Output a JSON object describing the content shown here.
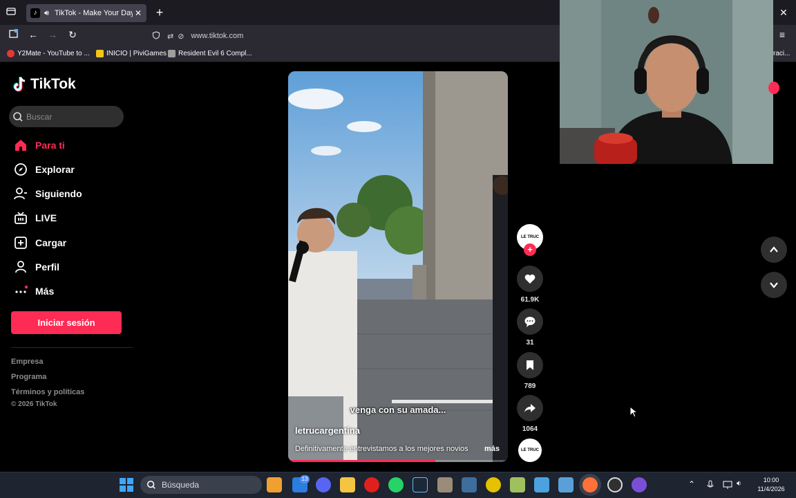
{
  "browser": {
    "tab_title": "TikTok - Make Your Day",
    "url": "www.tiktok.com",
    "bookmarks": [
      {
        "label": "Y2Mate - YouTube to ...",
        "color": "#e53935"
      },
      {
        "label": "INICIO | PiviGames",
        "color": "#f5c518"
      },
      {
        "label": "Resident Evil 6 Compl...",
        "color": "#9e9e9e"
      }
    ],
    "bookmark_overflow": "raci..."
  },
  "sidebar": {
    "brand": "TikTok",
    "search_placeholder": "Buscar",
    "nav": [
      {
        "label": "Para ti",
        "icon": "home-icon",
        "active": true
      },
      {
        "label": "Explorar",
        "icon": "compass-icon"
      },
      {
        "label": "Siguiendo",
        "icon": "following-icon"
      },
      {
        "label": "LIVE",
        "icon": "live-tv-icon"
      },
      {
        "label": "Cargar",
        "icon": "upload-icon"
      },
      {
        "label": "Perfil",
        "icon": "profile-icon"
      },
      {
        "label": "Más",
        "icon": "more-icon"
      }
    ],
    "login_button": "Iniciar sesión",
    "footer": [
      "Empresa",
      "Programa",
      "Términos y políticas"
    ],
    "copyright": "© 2026 TikTok"
  },
  "video": {
    "subtitle": "venga con su amada...",
    "author": "letrucargentina",
    "description": "Definitivamente entrevistamos a los mejores novios",
    "more": "más",
    "progress_fraction": 0.67
  },
  "actions": {
    "avatar_text": "LE TRUC",
    "likes": "61.9K",
    "comments": "31",
    "saves": "789",
    "shares": "1064"
  },
  "taskbar": {
    "search_label": "Búsqueda",
    "time": "10:00",
    "date": "11/4/2026",
    "badge_count": "13"
  },
  "colors": {
    "accent": "#fe2c55",
    "browser_bg": "#2b2a33",
    "taskbar_bg": "#1e2430"
  }
}
